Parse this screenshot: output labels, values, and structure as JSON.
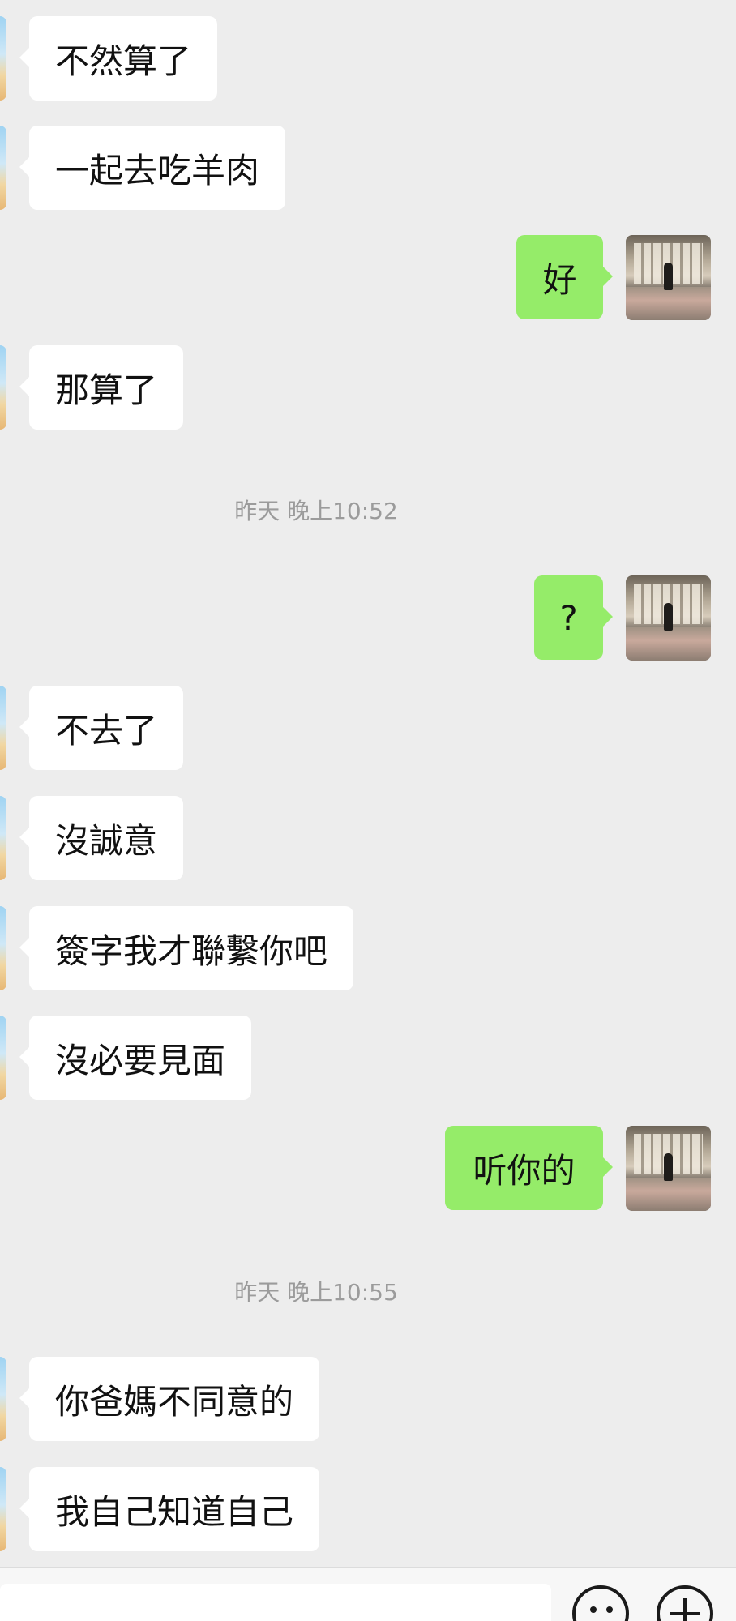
{
  "messages": [
    {
      "side": "in",
      "text": "不然算了"
    },
    {
      "side": "in",
      "text": "一起去吃羊肉"
    },
    {
      "side": "out",
      "text": "好"
    },
    {
      "side": "in",
      "text": "那算了"
    },
    {
      "side": "time",
      "text": "昨天 晚上10:52"
    },
    {
      "side": "out",
      "text": "?"
    },
    {
      "side": "in",
      "text": "不去了"
    },
    {
      "side": "in",
      "text": "沒誠意"
    },
    {
      "side": "in",
      "text": "簽字我才聯繫你吧"
    },
    {
      "side": "in",
      "text": "沒必要見面"
    },
    {
      "side": "out",
      "text": "听你的"
    },
    {
      "side": "time",
      "text": "昨天 晚上10:55"
    },
    {
      "side": "in",
      "text": "你爸媽不同意的"
    },
    {
      "side": "in",
      "text": "我自己知道自己"
    }
  ],
  "input_bar": {
    "emoji_icon": "emoji-icon",
    "plus_icon": "plus-icon"
  },
  "colors": {
    "background": "#ededed",
    "incoming_bubble": "#ffffff",
    "outgoing_bubble": "#95ec69",
    "timestamp_text": "#9b9b9b"
  }
}
